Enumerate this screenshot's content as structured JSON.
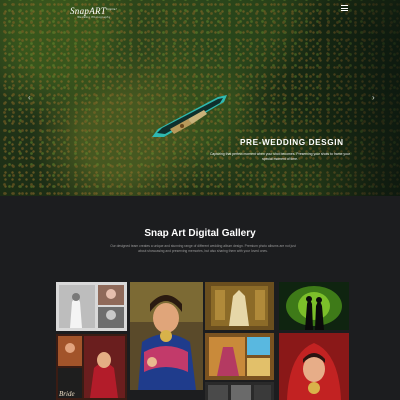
{
  "header": {
    "logo_main": "SnapART",
    "logo_sup": "Digital",
    "logo_sub": "Wedding Photography",
    "menu_icon": "hamburger-menu-icon"
  },
  "hero": {
    "title": "PRE-WEDDING DESGIN",
    "subtitle": "Capturing that perfect moment when your shot becomes. Preserving your shots to frame your special moment of time.",
    "prev_icon": "chevron-left-icon",
    "next_icon": "chevron-right-icon"
  },
  "gallery": {
    "title": "Snap Art Digital Gallery",
    "description": "Our designed team creates a unique and stunning range of different wedding album design. Premium photo albums are not just about showcasing and preserving memories, but also sharing them with your loved ones.",
    "photos": [
      {
        "name": "couple-collage-photo",
        "caption": ""
      },
      {
        "name": "bride-portrait-photo",
        "caption": ""
      },
      {
        "name": "bridal-dress-photo",
        "caption": ""
      },
      {
        "name": "silhouette-couple-photo",
        "caption": ""
      },
      {
        "name": "bride-collage-photo",
        "caption": "Bride"
      },
      {
        "name": "lehenga-album-photo",
        "caption": ""
      },
      {
        "name": "bride-red-veil-photo",
        "caption": ""
      },
      {
        "name": "album-collage-photo",
        "caption": ""
      }
    ]
  },
  "colors": {
    "page_background": "#1c1d1f",
    "hero_green": "#2f4a1b",
    "boat_teal": "#2fb9b0",
    "muted_text": "#9a9a9a"
  }
}
